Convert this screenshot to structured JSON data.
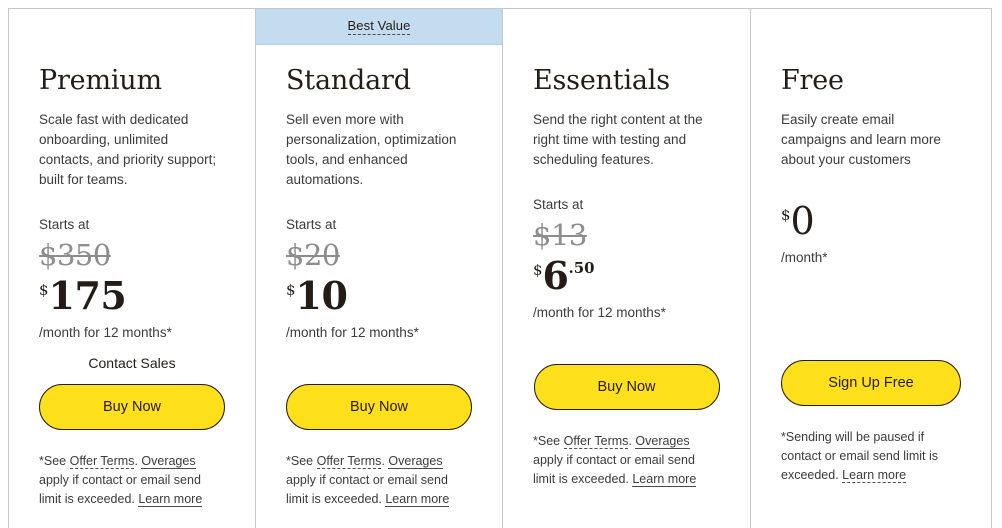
{
  "plans": [
    {
      "id": "premium",
      "badge": null,
      "name": "Premium",
      "description": "Scale fast with dedicated onboarding, unlimited contacts, and priority support; built for teams.",
      "starts_at_label": "Starts at",
      "old_price": "$350",
      "currency_symbol": "$",
      "price": "175",
      "cents": "",
      "per_month": "/month for 12 months*",
      "secondary_action": "Contact Sales",
      "cta_label": "Buy Now",
      "footnote": {
        "prefix": "*See ",
        "link_terms": "Offer Terms",
        "mid1": ". ",
        "link_overages": "Overages",
        "mid2": " apply if contact or email send limit is exceeded. ",
        "link_learn": "Learn more"
      }
    },
    {
      "id": "standard",
      "badge": "Best Value",
      "name": "Standard",
      "description": "Sell even more with personalization, optimization tools, and enhanced automations.",
      "starts_at_label": "Starts at",
      "old_price": "$20",
      "currency_symbol": "$",
      "price": "10",
      "cents": "",
      "per_month": "/month for 12 months*",
      "secondary_action": "",
      "cta_label": "Buy Now",
      "footnote": {
        "prefix": "*See ",
        "link_terms": "Offer Terms",
        "mid1": ". ",
        "link_overages": "Overages",
        "mid2": " apply if contact or email send limit is exceeded. ",
        "link_learn": "Learn more"
      }
    },
    {
      "id": "essentials",
      "badge": null,
      "name": "Essentials",
      "description": "Send the right content at the right time with testing and scheduling features.",
      "starts_at_label": "Starts at",
      "old_price": "$13",
      "currency_symbol": "$",
      "price": "6",
      "cents": ".50",
      "per_month": "/month for 12 months*",
      "secondary_action": "",
      "cta_label": "Buy Now",
      "footnote": {
        "prefix": "*See ",
        "link_terms": "Offer Terms",
        "mid1": ". ",
        "link_overages": "Overages",
        "mid2": " apply if contact or email send limit is exceeded. ",
        "link_learn": "Learn more"
      }
    },
    {
      "id": "free",
      "badge": null,
      "name": "Free",
      "description": "Easily create email campaigns and learn more about your customers",
      "starts_at_label": "",
      "old_price": "",
      "currency_symbol": "$",
      "price": "0",
      "cents": "",
      "per_month": "/month*",
      "secondary_action": "",
      "cta_label": "Sign Up Free",
      "footnote": {
        "prefix": "*Sending will be paused if contact or email send limit is exceeded. ",
        "link_terms": "",
        "mid1": "",
        "link_overages": "",
        "mid2": "",
        "link_learn": "Learn more"
      }
    }
  ],
  "theme": {
    "cta_background": "#ffe01b",
    "cta_border": "#241c15",
    "badge_background": "#c3dcf0",
    "text_primary": "#241c15",
    "text_secondary": "#3b3b3b",
    "old_price_color": "#8d8d8d",
    "divider": "#c7c7c7"
  }
}
